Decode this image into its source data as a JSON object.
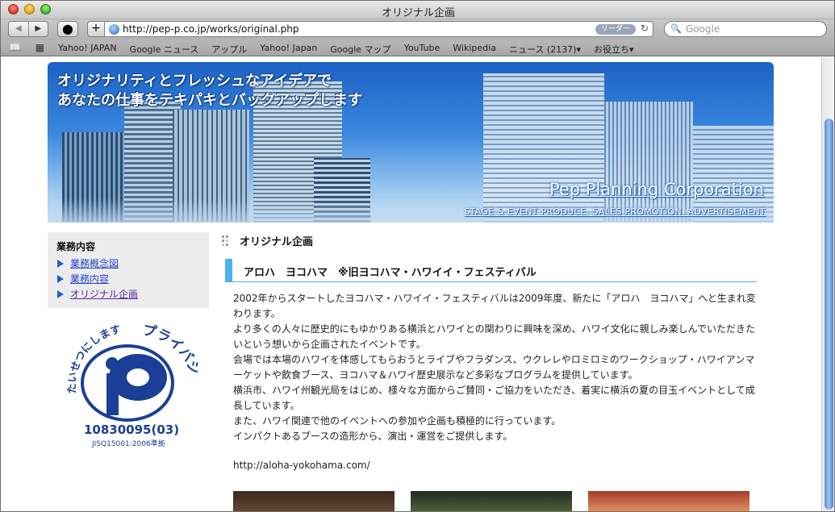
{
  "window": {
    "title": "オリジナル企画"
  },
  "toolbar": {
    "url": "http://pep-p.co.jp/works/original.php",
    "reader_label": "リーダー",
    "search_placeholder": "Google"
  },
  "bookmarks": [
    "Yahoo! JAPAN",
    "Google ニュース",
    "アップル",
    "Yahoo! Japan",
    "Google マップ",
    "YouTube",
    "Wikipedia",
    "ニュース (2137)▾",
    "お役立ち▾"
  ],
  "banner": {
    "slogan_line1": "オリジナリティとフレッシュなアイデアで",
    "slogan_line2": "あなたの仕事をテキパキとバックアップします",
    "company": "Pep Planning Corporation",
    "company_sub": "STAGE & EVENT PRODUCE, SALES PROMOTION, ADVERTISEMENT"
  },
  "sidebar": {
    "heading": "業務内容",
    "items": [
      {
        "label": "業務概念図"
      },
      {
        "label": "業務内容"
      },
      {
        "label": "オリジナル企画"
      }
    ]
  },
  "privacy_mark": {
    "arc_text": "たいせつにします",
    "arc_text2": "プライバシー",
    "number": "10830095(03)",
    "standard": "JISQ15001:2006準拠"
  },
  "main": {
    "section_title": "オリジナル企画",
    "heading": "アロハ　ヨコハマ　※旧ヨコハマ・ハワイイ・フェスティバル",
    "paragraphs": [
      "2002年からスタートしたヨコハマ・ハワイイ・フェスティバルは2009年度、新たに「アロハ　ヨコハマ」へと生まれ変わります。",
      "より多くの人々に歴史的にもゆかりある横浜とハワイとの関わりに興味を深め、ハワイ文化に親しみ楽しんでいただきたいという想いから企画されたイベントです。",
      "会場では本場のハワイを体感してもらおうとライブやフラダンス、ウクレレやロミロミのワークショップ・ハワイアンマーケットや飲食ブース、ヨコハマ＆ハワイ歴史展示など多彩なプログラムを提供しています。",
      "横浜市、ハワイ州観光局をはじめ、様々な方面からご賛同・ご協力をいただき、着実に横浜の夏の目玉イベントとして成長しています。",
      "また、ハワイ関連で他のイベントへの参加や企画も積極的に行っています。",
      "インパクトあるブースの造形から、演出・運営をご提供します。"
    ],
    "link": "http://aloha-yokohama.com/"
  }
}
